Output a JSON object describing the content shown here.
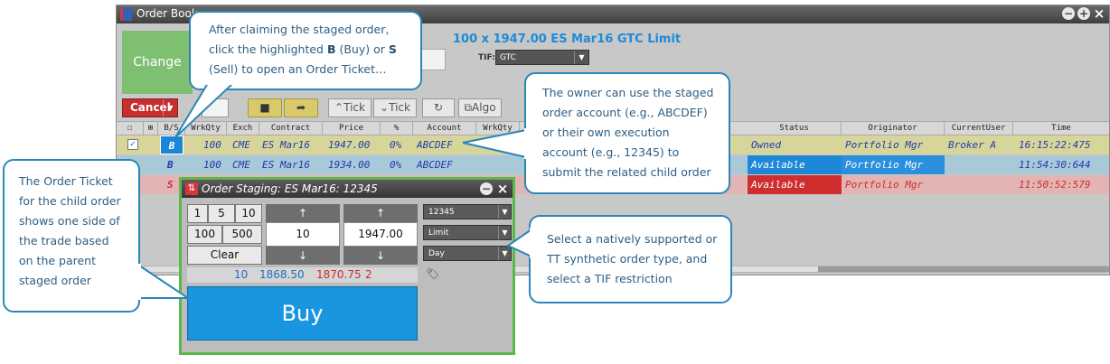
{
  "order_book": {
    "title": "Order Book",
    "change_label": "Change",
    "order_summary": "100 x 1947.00 ES Mar16 GTC Limit",
    "tif_label": "TIF:",
    "tif_value": "GTC",
    "cancel_label": "Cancel",
    "toolbar": {
      "tick_up": "Tick",
      "tick_down": "Tick",
      "algo": "Algo"
    },
    "columns": {
      "bs": "B/S",
      "wrkqty": "WrkQty",
      "exch": "Exch",
      "contract": "Contract",
      "price": "Price",
      "pct": "%",
      "account": "Account",
      "wrkqty2": "WrkQty",
      "status": "Status",
      "originator": "Originator",
      "currentuser": "CurrentUser",
      "time": "Time"
    },
    "rows": [
      {
        "side": "B",
        "qty": "100",
        "exch": "CME",
        "contract": "ES Mar16",
        "price": "1947.00",
        "pct": "0%",
        "account": "ABCDEF",
        "status": "Owned",
        "originator": "Portfolio Mgr",
        "currentuser": "Broker A",
        "time": "16:15:22:475"
      },
      {
        "side": "B",
        "qty": "100",
        "exch": "CME",
        "contract": "ES Mar16",
        "price": "1934.00",
        "pct": "0%",
        "account": "ABCDEF",
        "status": "Available",
        "originator": "Portfolio Mgr",
        "currentuser": "",
        "time": "11:54:30:644"
      },
      {
        "side": "S",
        "qty": "",
        "exch": "",
        "contract": "",
        "price": "",
        "pct": "",
        "account": "",
        "status": "Available",
        "originator": "Portfolio Mgr",
        "currentuser": "",
        "time": "11:50:52:579"
      }
    ]
  },
  "order_staging": {
    "title": "Order Staging: ES Mar16: 12345",
    "qty_buttons": [
      "1",
      "5",
      "10",
      "100",
      "500"
    ],
    "clear_label": "Clear",
    "quantity": "10",
    "price": "1947.00",
    "account": "12345",
    "order_type": "Limit",
    "tif": "Day",
    "market": {
      "bid_qty": "10",
      "bid_price": "1868.50",
      "ask_price": "1870.75",
      "ask_qty": "2"
    },
    "buy_label": "Buy"
  },
  "callouts": {
    "top": {
      "l1": "After claiming the staged order,",
      "l2a": "click the highlighted ",
      "l2b": "B",
      "l2c": " (Buy) or ",
      "l2d": "S",
      "l3": "(Sell) to open an Order Ticket…"
    },
    "right_top": [
      "The owner can use the staged",
      "order account (e.g., ABCDEF)",
      "or their own execution",
      "account (e.g., 12345) to",
      "submit the related child order"
    ],
    "left": [
      "The Order Ticket",
      "for the child order",
      "shows one side of",
      "the trade based",
      "on the parent",
      "staged order"
    ],
    "right_bottom": [
      "Select a natively supported or",
      "TT synthetic order type, and",
      "select a TIF restriction"
    ]
  },
  "colors": {
    "accent": "#1a96e0",
    "callout_border": "#2a86b8",
    "green_frame": "#5cb84a",
    "cancel_red": "#c62f2f"
  }
}
